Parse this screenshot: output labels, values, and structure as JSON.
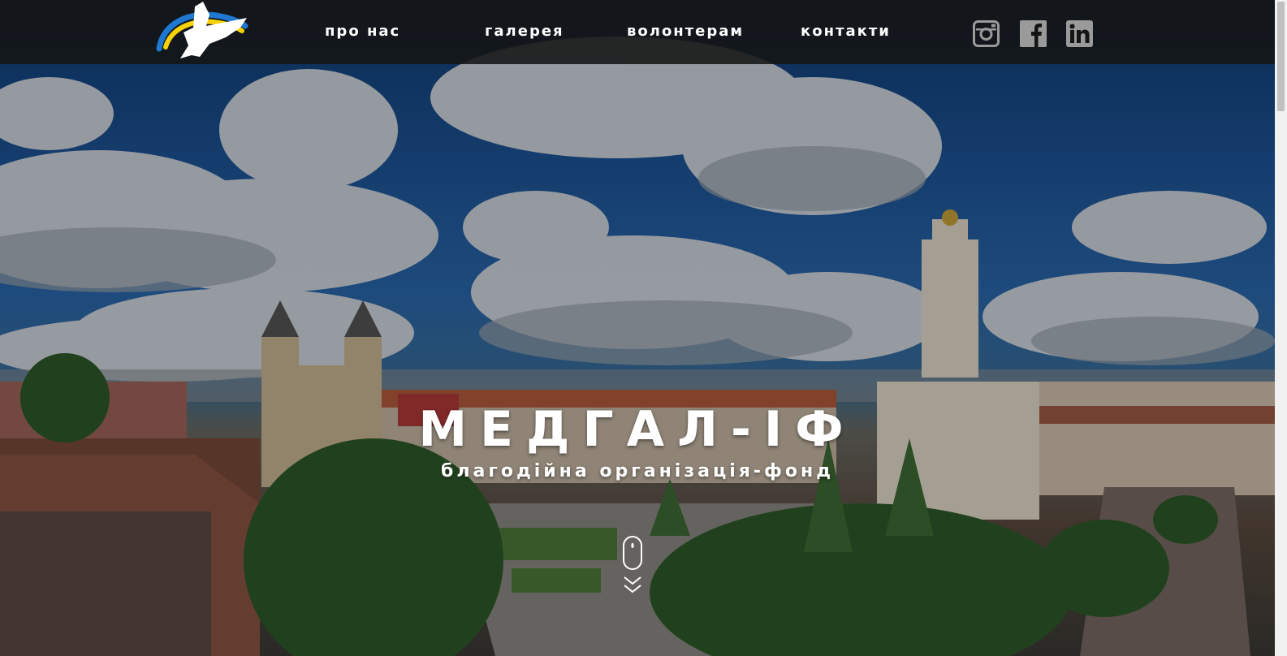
{
  "header": {
    "logo_icon": "dove-logo-icon",
    "nav": [
      {
        "label": "про нас"
      },
      {
        "label": "галерея"
      },
      {
        "label": "волонтерам"
      },
      {
        "label": "контакти"
      }
    ],
    "social": [
      {
        "icon": "instagram-icon"
      },
      {
        "icon": "facebook-icon"
      },
      {
        "icon": "linkedin-icon"
      }
    ]
  },
  "hero": {
    "title": "МЕДГАЛ-ІФ",
    "subtitle": "благодійна організація-фонд",
    "scroll_icon": "mouse-scroll-icon"
  },
  "colors": {
    "header_bg": "#141414",
    "text": "#ffffff",
    "sky": "#1d5598",
    "logo_blue": "#1f78d1",
    "logo_yellow": "#f5d20a"
  }
}
